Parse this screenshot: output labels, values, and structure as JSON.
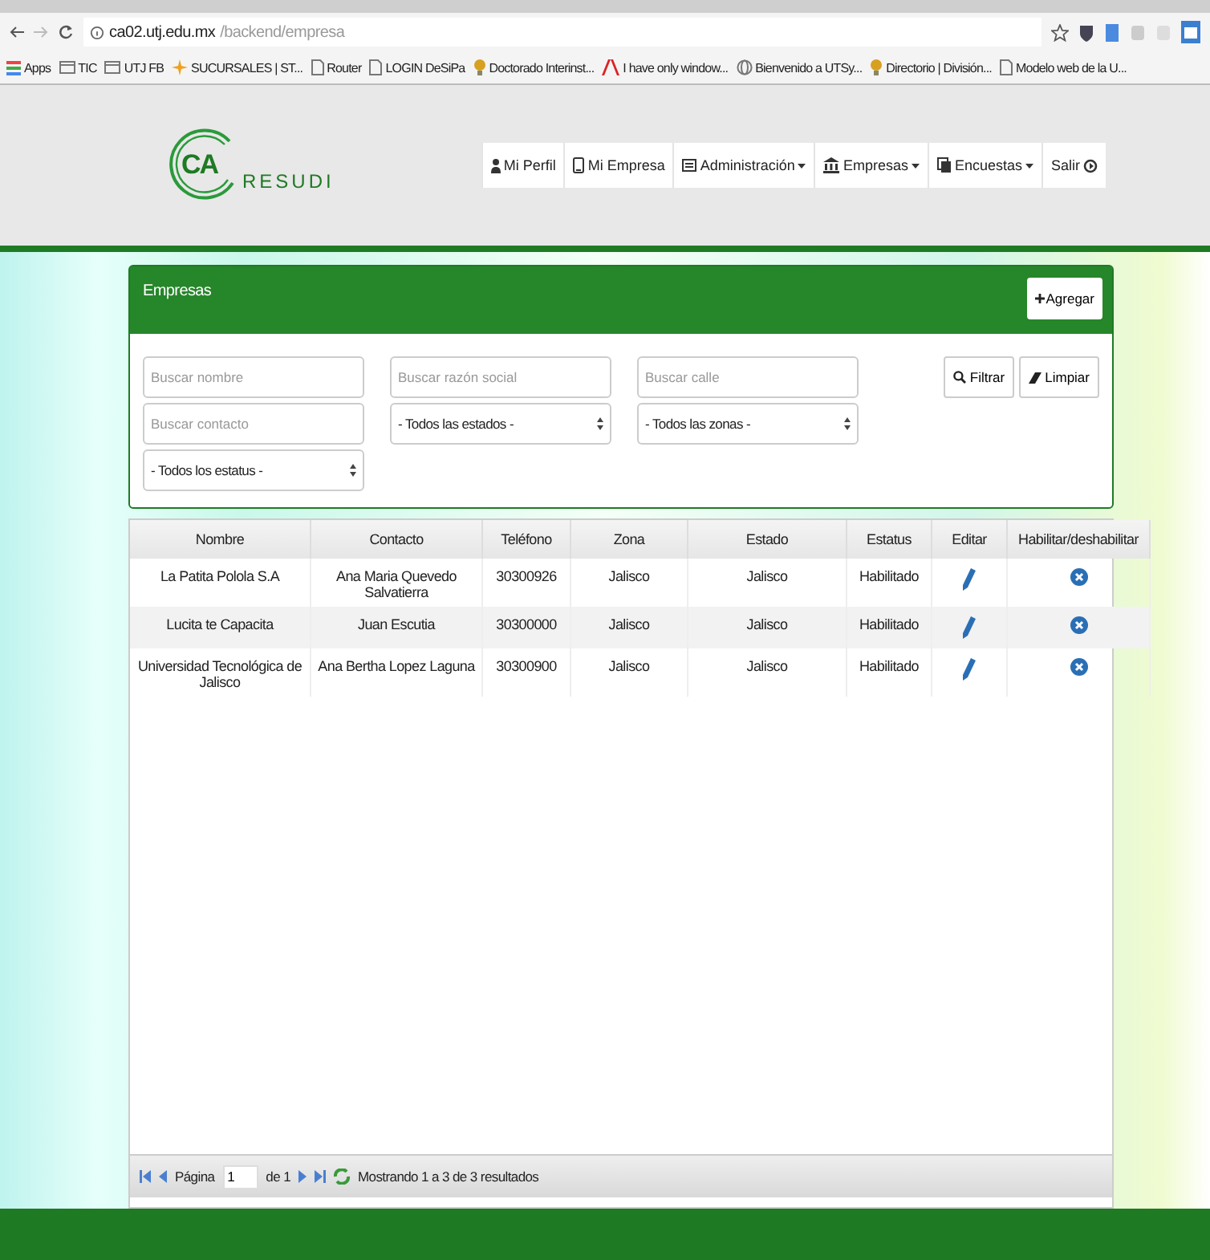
{
  "browser": {
    "url_host": "ca02.utj.edu.mx",
    "url_path": "/backend/empresa",
    "bookmarks": [
      {
        "label": "Apps",
        "kind": "grid"
      },
      {
        "label": "TIC",
        "kind": "folder"
      },
      {
        "label": "UTJ FB",
        "kind": "folder"
      },
      {
        "label": "SUCURSALES | ST...",
        "kind": "star"
      },
      {
        "label": "Router",
        "kind": "page"
      },
      {
        "label": "LOGIN DeSiPa",
        "kind": "page"
      },
      {
        "label": "Doctorado Interinst...",
        "kind": "bulb"
      },
      {
        "label": "I have only window...",
        "kind": "adobe"
      },
      {
        "label": "Bienvenido a UTSy...",
        "kind": "globe"
      },
      {
        "label": "Directorio | División...",
        "kind": "bulb"
      },
      {
        "label": "Modelo web de la U...",
        "kind": "page"
      }
    ]
  },
  "header": {
    "logo": {
      "mark": "CA",
      "name": "RESUDI"
    },
    "nav": [
      {
        "label": "Mi Perfil",
        "kind": "user",
        "dropdown": false
      },
      {
        "label": "Mi Empresa",
        "kind": "phone",
        "dropdown": false
      },
      {
        "label": "Administración",
        "kind": "list",
        "dropdown": true
      },
      {
        "label": "Empresas",
        "kind": "bank",
        "dropdown": true
      },
      {
        "label": "Encuestas",
        "kind": "copy",
        "dropdown": true
      },
      {
        "label": "Salir",
        "kind": "exit",
        "dropdown": false
      }
    ]
  },
  "panel": {
    "title": "Empresas",
    "add_button": "Agregar",
    "filters": [
      {
        "kind": "text",
        "placeholder": "Buscar nombre"
      },
      {
        "kind": "text",
        "placeholder": "Buscar razón social"
      },
      {
        "kind": "text",
        "placeholder": "Buscar calle"
      },
      {
        "kind": "text",
        "placeholder": "Buscar contacto"
      },
      {
        "kind": "select",
        "value": "- Todos las estados -"
      },
      {
        "kind": "select",
        "value": "- Todos las zonas -"
      },
      {
        "kind": "select",
        "value": "- Todos los estatus -"
      }
    ],
    "filter_button": "Filtrar",
    "clear_button": "Limpiar"
  },
  "table": {
    "columns": [
      "Nombre",
      "Contacto",
      "Teléfono",
      "Zona",
      "Estado",
      "Estatus",
      "Editar",
      "Habilitar/deshabilitar"
    ],
    "rows": [
      {
        "cells": [
          "La Patita Polola S.A",
          "Ana Maria Quevedo Salvatierra",
          "30300926",
          "Jalisco",
          "Jalisco",
          "Habilitado"
        ]
      },
      {
        "cells": [
          "Lucita te Capacita",
          "Juan Escutia",
          "30300000",
          "Jalisco",
          "Jalisco",
          "Habilitado"
        ]
      },
      {
        "cells": [
          "Universidad Tecnológica de Jalisco",
          "Ana Bertha Lopez Laguna",
          "30300900",
          "Jalisco",
          "Jalisco",
          "Habilitado"
        ]
      }
    ]
  },
  "pager": {
    "page_label": "Página",
    "page_value": "1",
    "of_label": "de 1",
    "summary": "Mostrando 1 a 3 de 3 resultados"
  }
}
